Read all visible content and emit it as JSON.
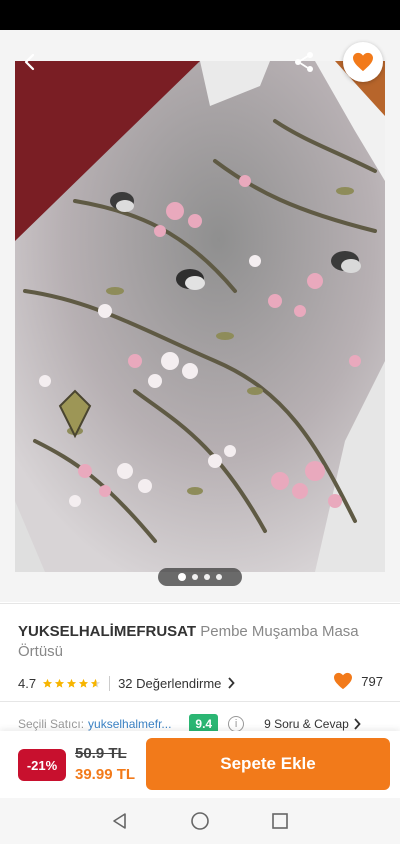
{
  "product": {
    "brand": "YUKSELHALİMEFRUSAT",
    "name": " Pembe Muşamba Masa Örtüsü",
    "rating": "4.7",
    "reviews_label": "32 Değerlendirme",
    "like_count": "797",
    "image_index": 1,
    "image_count": 4
  },
  "seller": {
    "label": "Seçili Satıcı:",
    "name": "yukselhalmefr...",
    "score": "9.4"
  },
  "qa_label": "9 Soru & Cevap",
  "price": {
    "discount": "-21%",
    "old": "50.9 TL",
    "new": "39.99 TL"
  },
  "cart_button_label": "Sepete Ekle",
  "colors": {
    "accent": "#f27a1a",
    "discount": "#c8102e",
    "seller_score": "#2bb673"
  },
  "icons": {
    "back": "arrow-left-icon",
    "share": "share-icon",
    "favorite": "heart-icon",
    "star": "star-icon",
    "chevron": "chevron-right-icon",
    "nav": [
      "nav-back-icon",
      "nav-home-icon",
      "nav-recents-icon"
    ]
  }
}
